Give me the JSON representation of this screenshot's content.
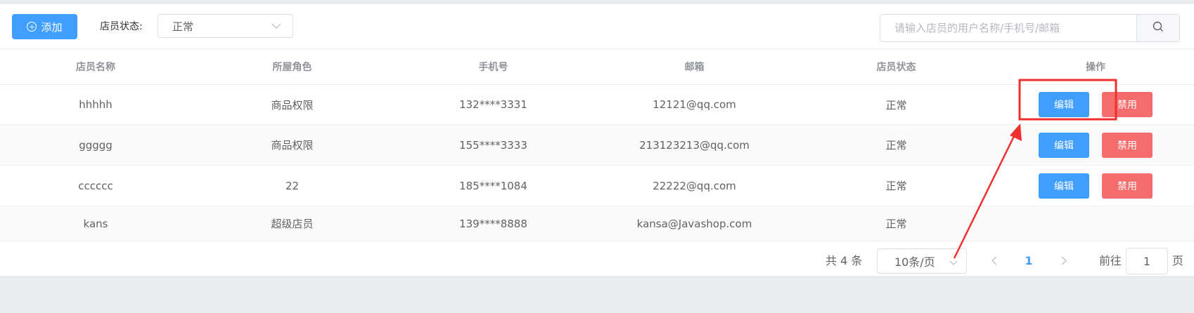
{
  "toolbar": {
    "add_label": "添加",
    "status_label": "店员状态:",
    "status_value": "正常",
    "search_placeholder": "请输入店员的用户名称/手机号/邮箱"
  },
  "table": {
    "headers": [
      "店员名称",
      "所屋角色",
      "手机号",
      "邮箱",
      "店员状态",
      "操作"
    ],
    "rows": [
      {
        "name": "hhhhh",
        "role": "商品权限",
        "phone": "132****3331",
        "email": "12121@qq.com",
        "status": "正常",
        "edit": "编辑",
        "disable": "禁用"
      },
      {
        "name": "ggggg",
        "role": "商品权限",
        "phone": "155****3333",
        "email": "213123213@qq.com",
        "status": "正常",
        "edit": "编辑",
        "disable": "禁用"
      },
      {
        "name": "cccccc",
        "role": "22",
        "phone": "185****1084",
        "email": "22222@qq.com",
        "status": "正常",
        "edit": "编辑",
        "disable": "禁用"
      },
      {
        "name": "kans",
        "role": "超级店员",
        "phone": "139****8888",
        "email": "kansa@Javashop.com",
        "status": "正常"
      }
    ]
  },
  "pagination": {
    "total": "共 4 条",
    "page_size": "10条/页",
    "current_page": "1",
    "goto_label": "前往",
    "goto_value": "1",
    "page_suffix": "页"
  },
  "annotation": {
    "color": "#f0302e"
  },
  "colors": {
    "primary": "#409eff",
    "danger": "#f56c6c"
  }
}
